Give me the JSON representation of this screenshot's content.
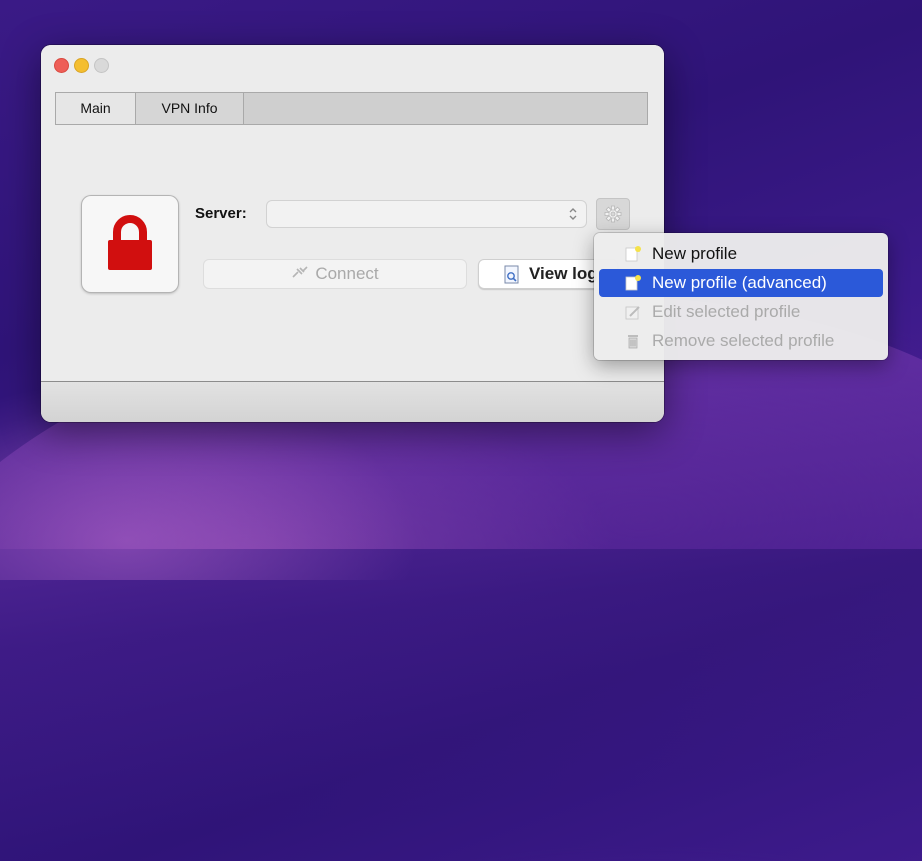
{
  "window": {
    "tabs": [
      {
        "label": "Main"
      },
      {
        "label": "VPN Info"
      }
    ]
  },
  "main": {
    "lock_icon": "padlock-icon",
    "server_label": "Server:",
    "server_value": "",
    "connect_label": "Connect",
    "viewlog_label": "View log"
  },
  "menu": {
    "items": [
      {
        "label": "New profile",
        "icon": "new-document-icon",
        "state": "normal"
      },
      {
        "label": "New profile (advanced)",
        "icon": "new-document-icon",
        "state": "highlighted"
      },
      {
        "label": "Edit selected profile",
        "icon": "edit-pencil-icon",
        "state": "disabled"
      },
      {
        "label": "Remove selected profile",
        "icon": "trash-icon",
        "state": "disabled"
      }
    ]
  },
  "colors": {
    "lock_red": "#d10f0f",
    "menu_highlight": "#2b59d9"
  }
}
